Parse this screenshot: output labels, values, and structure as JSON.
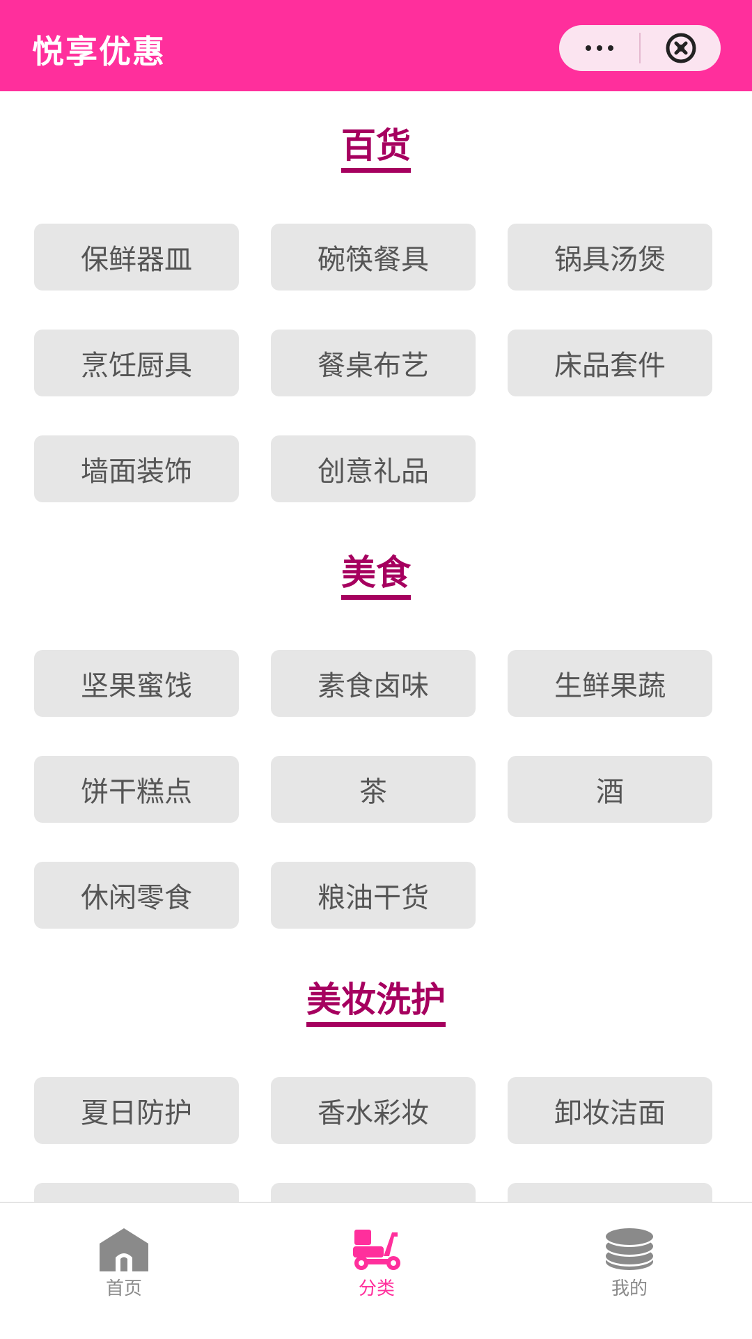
{
  "header": {
    "title": "悦享优惠"
  },
  "sections": [
    {
      "title": "百货",
      "items": [
        "保鲜器皿",
        "碗筷餐具",
        "锅具汤煲",
        "烹饪厨具",
        "餐桌布艺",
        "床品套件",
        "墙面装饰",
        "创意礼品"
      ]
    },
    {
      "title": "美食",
      "items": [
        "坚果蜜饯",
        "素食卤味",
        "生鲜果蔬",
        "饼干糕点",
        "茶",
        "酒",
        "休闲零食",
        "粮油干货"
      ]
    },
    {
      "title": "美妆洗护",
      "items": [
        "夏日防护",
        "香水彩妆",
        "卸妆洁面",
        "",
        "",
        ""
      ]
    }
  ],
  "tabbar": {
    "home": "首页",
    "category": "分类",
    "mine": "我的",
    "active_color": "#ff2f9c",
    "inactive_color": "#8a8a8a"
  },
  "colors": {
    "brand": "#ff2f9c",
    "section_title": "#a6005f"
  }
}
